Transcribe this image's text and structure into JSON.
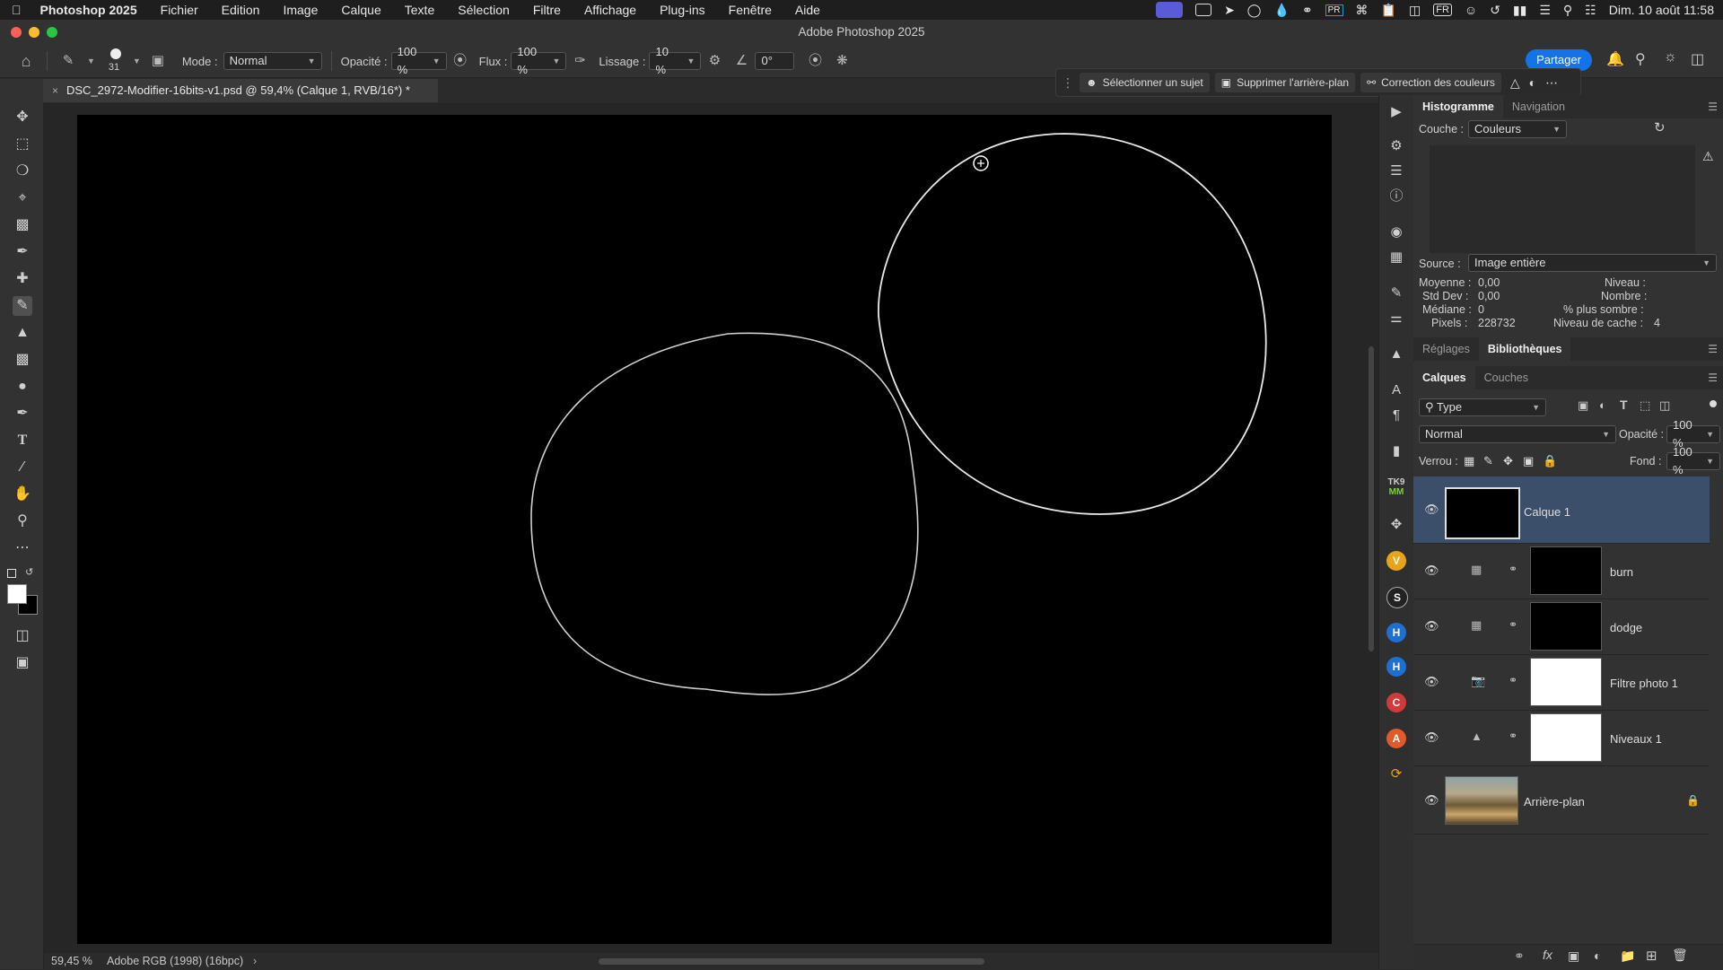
{
  "menubar": {
    "app": "Photoshop 2025",
    "items": [
      "Fichier",
      "Edition",
      "Image",
      "Calque",
      "Texte",
      "Sélection",
      "Filtre",
      "Affichage",
      "Plug-ins",
      "Fenêtre",
      "Aide"
    ],
    "lang": "FR",
    "datetime": "Dim. 10 août 11:58"
  },
  "window": {
    "title": "Adobe Photoshop 2025"
  },
  "options": {
    "brush_size": "31",
    "mode_label": "Mode :",
    "mode_value": "Normal",
    "opacity_label": "Opacité :",
    "opacity_value": "100 %",
    "flux_label": "Flux :",
    "flux_value": "100 %",
    "lissage_label": "Lissage :",
    "lissage_value": "10 %",
    "angle_value": "0°",
    "share": "Partager"
  },
  "context_bar": {
    "select_subject": "Sélectionner un sujet",
    "remove_bg": "Supprimer l'arrière-plan",
    "color_correction": "Correction des couleurs"
  },
  "document": {
    "tab_title": "DSC_2972-Modifier-16bits-v1.psd @ 59,4% (Calque 1, RVB/16*) *",
    "zoom": "59,45 %",
    "profile": "Adobe RGB (1998) (16bpc)"
  },
  "histogram": {
    "tab1": "Histogramme",
    "tab2": "Navigation",
    "couche_label": "Couche :",
    "couche_value": "Couleurs",
    "source_label": "Source :",
    "source_value": "Image entière",
    "moyenne_label": "Moyenne :",
    "moyenne": "0,00",
    "stddev_label": "Std Dev :",
    "stddev": "0,00",
    "mediane_label": "Médiane :",
    "mediane": "0",
    "pixels_label": "Pixels :",
    "pixels": "228732",
    "niveau_label": "Niveau :",
    "nombre_label": "Nombre :",
    "sombre_label": "% plus sombre :",
    "cache_label": "Niveau de cache :",
    "cache": "4"
  },
  "adjust_tabs": {
    "tab1": "Réglages",
    "tab2": "Bibliothèques"
  },
  "layers": {
    "tab1": "Calques",
    "tab2": "Couches",
    "filter": "Type",
    "blend": "Normal",
    "opacity_label": "Opacité :",
    "opacity_value": "100 %",
    "lock_label": "Verrou :",
    "fill_label": "Fond :",
    "fill_value": "100 %",
    "items": [
      {
        "name": "Calque 1"
      },
      {
        "name": "burn"
      },
      {
        "name": "dodge"
      },
      {
        "name": "Filtre photo 1"
      },
      {
        "name": "Niveaux 1"
      },
      {
        "name": "Arrière-plan"
      }
    ]
  },
  "plugins": [
    "TK9",
    "MM",
    "V",
    "S",
    "H",
    "H",
    "C",
    "A"
  ],
  "colors": {
    "accent": "#1473e6",
    "selected_layer": "#3b4f6b"
  }
}
